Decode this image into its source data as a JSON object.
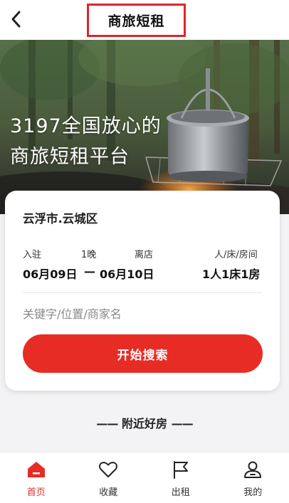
{
  "header": {
    "title": "商旅短租",
    "back_icon": "chevron-left-icon"
  },
  "hero": {
    "slogan_line1": "3197全国放心的",
    "slogan_line2": "商旅短租平台"
  },
  "search_card": {
    "city": "云浮市.云城区",
    "checkin_label": "入驻",
    "nights_label": "1晚",
    "checkout_label": "离店",
    "guests_label": "人/床/房间",
    "checkin_date": "06月09日",
    "date_separator": "—",
    "checkout_date": "06月10日",
    "guests_value": "1人1床1房",
    "keyword_placeholder": "关键字/位置/商家名",
    "search_button": "开始搜索"
  },
  "section": {
    "dash_left": "——",
    "title": "附近好房",
    "dash_right": "——"
  },
  "tabbar": {
    "items": [
      {
        "label": "首页",
        "icon": "home-icon",
        "active": true
      },
      {
        "label": "收藏",
        "icon": "heart-icon",
        "active": false
      },
      {
        "label": "出租",
        "icon": "flag-icon",
        "active": false
      },
      {
        "label": "我的",
        "icon": "user-icon",
        "active": false
      }
    ]
  },
  "colors": {
    "accent": "#e72c25",
    "title_highlight_border": "#e0242b",
    "background": "#f3f3f5"
  }
}
